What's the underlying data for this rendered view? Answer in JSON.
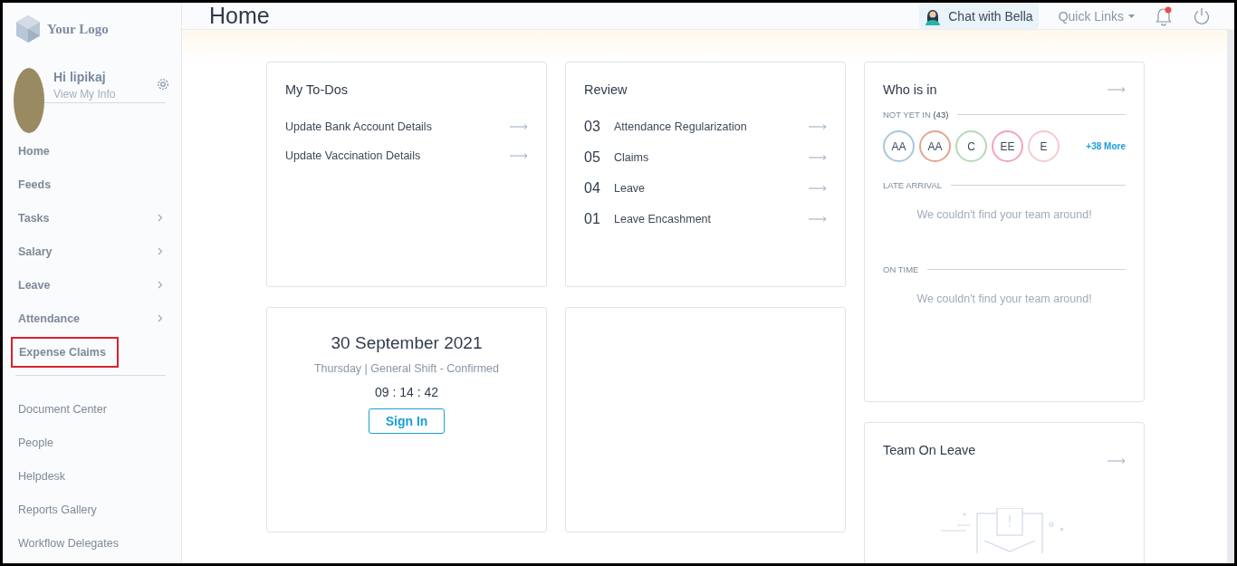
{
  "logo": {
    "text": "Your Logo"
  },
  "header": {
    "title": "Home",
    "chat": "Chat with Bella",
    "quick_links": "Quick Links",
    "notification_unread": true
  },
  "user": {
    "greeting": "Hi lipikaj",
    "link": "View My Info"
  },
  "nav": [
    {
      "label": "Home",
      "submenu": false,
      "highlighted": false
    },
    {
      "label": "Feeds",
      "submenu": false,
      "highlighted": false
    },
    {
      "label": "Tasks",
      "submenu": true,
      "highlighted": false
    },
    {
      "label": "Salary",
      "submenu": true,
      "highlighted": false
    },
    {
      "label": "Leave",
      "submenu": true,
      "highlighted": false
    },
    {
      "label": "Attendance",
      "submenu": true,
      "highlighted": false
    },
    {
      "label": "Expense Claims",
      "submenu": false,
      "highlighted": true
    }
  ],
  "nav_secondary": [
    {
      "label": "Document Center"
    },
    {
      "label": "People"
    },
    {
      "label": "Helpdesk"
    },
    {
      "label": "Reports Gallery"
    },
    {
      "label": "Workflow Delegates"
    }
  ],
  "todos": {
    "title": "My To-Dos",
    "items": [
      "Update Bank Account Details",
      "Update Vaccination Details"
    ]
  },
  "review": {
    "title": "Review",
    "items": [
      {
        "count": "03",
        "label": "Attendance Regularization"
      },
      {
        "count": "05",
        "label": "Claims"
      },
      {
        "count": "04",
        "label": "Leave"
      },
      {
        "count": "01",
        "label": "Leave Encashment"
      }
    ]
  },
  "attendance": {
    "date": "30 September 2021",
    "shift": "Thursday | General Shift - Confirmed",
    "time": "09 : 14 : 42",
    "button": "Sign In"
  },
  "who_is_in": {
    "title": "Who is in",
    "not_yet_in": {
      "label": "NOT YET IN",
      "count": "(43)"
    },
    "avatars": [
      {
        "initials": "AA",
        "color": "#a9c6dc"
      },
      {
        "initials": "AA",
        "color": "#e3a58e"
      },
      {
        "initials": "C",
        "color": "#b5dab5"
      },
      {
        "initials": "EE",
        "color": "#f3a3bd"
      },
      {
        "initials": "E",
        "color": "#f6c9cf"
      }
    ],
    "more": "+38 More",
    "sections": [
      {
        "label": "LATE ARRIVAL",
        "message": "We couldn't find your team around!"
      },
      {
        "label": "ON TIME",
        "message": "We couldn't find your team around!"
      }
    ]
  },
  "team_on_leave": {
    "title": "Team On Leave"
  }
}
